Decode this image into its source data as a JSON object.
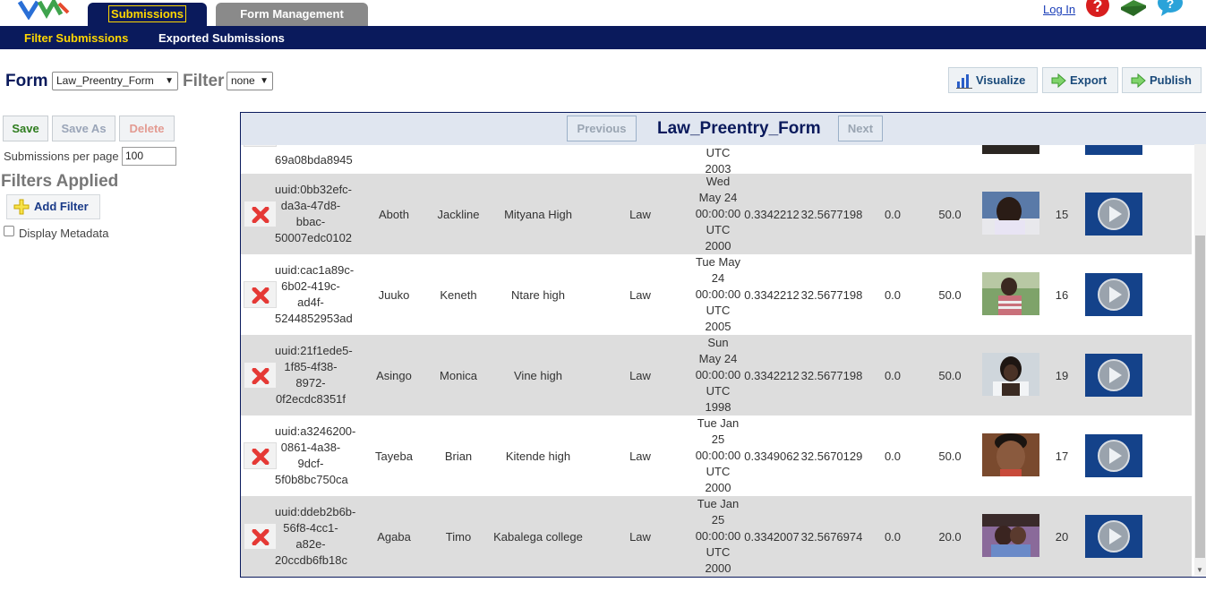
{
  "header": {
    "tabs": [
      {
        "label": "Submissions",
        "active": true
      },
      {
        "label": "Form Management",
        "active": false
      }
    ],
    "login_label": "Log In",
    "icons": [
      "logo",
      "help-icon",
      "book-icon",
      "chat-icon"
    ]
  },
  "subnav": {
    "items": [
      {
        "label": "Filter Submissions",
        "active": true
      },
      {
        "label": "Exported Submissions",
        "active": false
      }
    ]
  },
  "toolbar": {
    "form_label": "Form",
    "form_value": "Law_Preentry_Form",
    "filter_label": "Filter",
    "filter_value": "none",
    "visualize_label": "Visualize",
    "export_label": "Export",
    "publish_label": "Publish"
  },
  "left_panel": {
    "save_label": "Save",
    "save_as_label": "Save As",
    "delete_label": "Delete",
    "per_page_label": "Submissions per page",
    "per_page_value": "100",
    "filters_title": "Filters Applied",
    "add_filter_label": "Add Filter",
    "display_metadata_label": "Display Metadata"
  },
  "panel": {
    "title": "Law_Preentry_Form",
    "previous_label": "Previous",
    "next_label": "Next"
  },
  "partial_row": {
    "uuid_tail": "69a08bda8945",
    "date_lines": [
      "UTC",
      "2003"
    ]
  },
  "rows": [
    {
      "uuid_lines": [
        "uuid:0bb32efc-",
        "da3a-47d8-",
        "bbac-",
        "50007edc0102"
      ],
      "first": "Aboth",
      "last": "Jackline",
      "school": "Mityana High",
      "subject": "Law",
      "date_lines": [
        "Wed",
        "May 24",
        "00:00:00",
        "UTC",
        "2000"
      ],
      "lat": "0.3342212",
      "lon": "32.5677198",
      "alt": "0.0",
      "acc": "50.0",
      "num": "15"
    },
    {
      "uuid_lines": [
        "uuid:cac1a89c-",
        "6b02-419c-",
        "ad4f-",
        "5244852953ad"
      ],
      "first": "Juuko",
      "last": "Keneth",
      "school": "Ntare high",
      "subject": "Law",
      "date_lines": [
        "Tue May",
        "24",
        "00:00:00",
        "UTC",
        "2005"
      ],
      "lat": "0.3342212",
      "lon": "32.5677198",
      "alt": "0.0",
      "acc": "50.0",
      "num": "16"
    },
    {
      "uuid_lines": [
        "uuid:21f1ede5-",
        "1f85-4f38-",
        "8972-",
        "0f2ecdc8351f"
      ],
      "first": "Asingo",
      "last": "Monica",
      "school": "Vine high",
      "subject": "Law",
      "date_lines": [
        "Sun",
        "May 24",
        "00:00:00",
        "UTC",
        "1998"
      ],
      "lat": "0.3342212",
      "lon": "32.5677198",
      "alt": "0.0",
      "acc": "50.0",
      "num": "19"
    },
    {
      "uuid_lines": [
        "uuid:a3246200-",
        "0861-4a38-",
        "9dcf-",
        "5f0b8bc750ca"
      ],
      "first": "Tayeba",
      "last": "Brian",
      "school": "Kitende high",
      "subject": "Law",
      "date_lines": [
        "Tue Jan",
        "25",
        "00:00:00",
        "UTC",
        "2000"
      ],
      "lat": "0.3349062",
      "lon": "32.5670129",
      "alt": "0.0",
      "acc": "50.0",
      "num": "17"
    },
    {
      "uuid_lines": [
        "uuid:ddeb2b6b-",
        "56f8-4cc1-",
        "a82e-",
        "20ccdb6fb18c"
      ],
      "first": "Agaba",
      "last": "Timo",
      "school": "Kabalega college",
      "subject": "Law",
      "date_lines": [
        "Tue Jan",
        "25",
        "00:00:00",
        "UTC",
        "2000"
      ],
      "lat": "0.3342007",
      "lon": "32.5676974",
      "alt": "0.0",
      "acc": "20.0",
      "num": "20"
    }
  ]
}
